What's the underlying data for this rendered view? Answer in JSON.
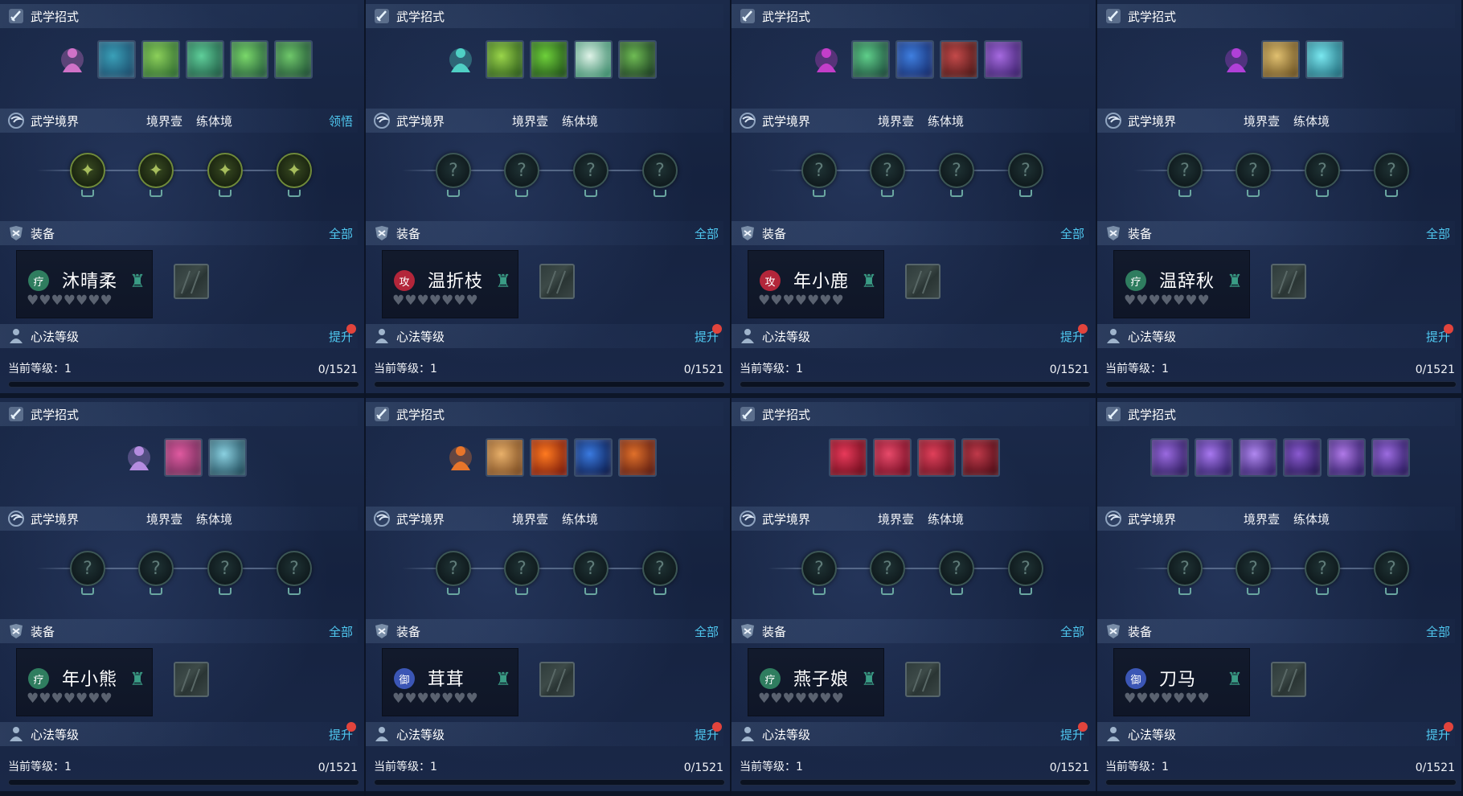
{
  "labels": {
    "moves": "武学招式",
    "realm": "武学境界",
    "realm_stage": "境界壹",
    "realm_type": "练体境",
    "comprehend": "领悟",
    "equip": "装备",
    "equip_all": "全部",
    "heart": "心法等级",
    "upgrade": "提升",
    "current_level_prefix": "当前等级：",
    "realm_unknown_glyph": "?"
  },
  "colors": {
    "accent": "#4fc7ef",
    "badge_heal": "#2f7d5f",
    "badge_attack": "#b3263a",
    "badge_defend": "#3b56b5",
    "red_dot": "#e2443c"
  },
  "characters": [
    {
      "name": "沐晴柔",
      "badge": "疗",
      "badge_type": "heal",
      "main_icon": "pink-figure-icon",
      "main_color": "#d072c8",
      "skills": [
        {
          "icon": "water-dragon-skill-icon",
          "colors": [
            "#3aa0b8",
            "#1b4a6a"
          ]
        },
        {
          "icon": "green-wind-skill-icon",
          "colors": [
            "#8cd05a",
            "#2e6a2f"
          ]
        },
        {
          "icon": "green-swirl-skill-icon",
          "colors": [
            "#5fcf9a",
            "#1f5a44"
          ]
        },
        {
          "icon": "green-leaf-skill-icon",
          "colors": [
            "#7ad86a",
            "#245a3a"
          ]
        },
        {
          "icon": "green-serpent-skill-icon",
          "colors": [
            "#6fc86a",
            "#1e4e34"
          ]
        }
      ],
      "realm_nodes_unlocked": true,
      "show_comprehend": true,
      "realm_icons": [
        "butterfly-icon",
        "crescent-icon",
        "lotus-icon",
        "crown-icon"
      ],
      "hearts": "♥♥♥♥♥♥♥",
      "level": "1",
      "exp": "0/1521",
      "progress": 0
    },
    {
      "name": "温折枝",
      "badge": "攻",
      "badge_type": "attack",
      "main_icon": "teal-figure-icon",
      "main_color": "#4fd0c4",
      "skills": [
        {
          "icon": "green-claw-skill-icon",
          "colors": [
            "#9ad54a",
            "#2c5a1a"
          ]
        },
        {
          "icon": "green-blade-skill-icon",
          "colors": [
            "#6ed03a",
            "#1f4f18"
          ]
        },
        {
          "icon": "white-ring-skill-icon",
          "colors": [
            "#dff3e8",
            "#3a8a6a"
          ]
        },
        {
          "icon": "green-yin-yang-skill-icon",
          "colors": [
            "#6fbc54",
            "#193a20"
          ]
        }
      ],
      "realm_nodes_unlocked": false,
      "show_comprehend": false,
      "hearts": "♥♥♥♥♥♥♥",
      "level": "1",
      "exp": "0/1521",
      "progress": 0
    },
    {
      "name": "年小鹿",
      "badge": "攻",
      "badge_type": "attack",
      "main_icon": "purple-orb-icon",
      "main_color": "#c33ec9",
      "skills": [
        {
          "icon": "green-burst-skill-icon",
          "colors": [
            "#5fcf8a",
            "#1b4a3a"
          ]
        },
        {
          "icon": "blue-wave-skill-icon",
          "colors": [
            "#3f7fe0",
            "#142a6a"
          ]
        },
        {
          "icon": "red-beast-skill-icon",
          "colors": [
            "#c44a4a",
            "#4a1616"
          ]
        },
        {
          "icon": "purple-mist-skill-icon",
          "colors": [
            "#a66ae0",
            "#3a1f6a"
          ]
        }
      ],
      "realm_nodes_unlocked": false,
      "show_comprehend": false,
      "hearts": "♥♥♥♥♥♥♥",
      "level": "1",
      "exp": "0/1521",
      "progress": 0
    },
    {
      "name": "温辞秋",
      "badge": "疗",
      "badge_type": "heal",
      "main_icon": "violet-figure-icon",
      "main_color": "#b040d8",
      "skills": [
        {
          "icon": "golden-wings-skill-icon",
          "colors": [
            "#e0c070",
            "#6a5020"
          ]
        },
        {
          "icon": "cyan-sun-skill-icon",
          "colors": [
            "#7ae8f0",
            "#1f6a7a"
          ]
        }
      ],
      "realm_nodes_unlocked": false,
      "show_comprehend": false,
      "hearts": "♥♥♥♥♥♥♥",
      "level": "1",
      "exp": "0/1521",
      "progress": 0
    },
    {
      "name": "年小熊",
      "badge": "疗",
      "badge_type": "heal",
      "main_icon": "purple-bell-icon",
      "main_color": "#b58ce0",
      "skills": [
        {
          "icon": "pink-bird-skill-icon",
          "colors": [
            "#e05aa0",
            "#6a2a55"
          ]
        },
        {
          "icon": "ice-shark-skill-icon",
          "colors": [
            "#8ad0e0",
            "#1f4a5a"
          ]
        }
      ],
      "realm_nodes_unlocked": false,
      "show_comprehend": false,
      "hearts": "♥♥♥♥♥♥♥",
      "level": "1",
      "exp": "0/1521",
      "progress": 0
    },
    {
      "name": "茸茸",
      "badge": "御",
      "badge_type": "defend",
      "main_icon": "flame-figure-icon",
      "main_color": "#e8752a",
      "skills": [
        {
          "icon": "golden-buddha-skill-icon",
          "colors": [
            "#e8b06a",
            "#7a4a20"
          ]
        },
        {
          "icon": "fire-blast-skill-icon",
          "colors": [
            "#ff7a20",
            "#7a1a0a"
          ]
        },
        {
          "icon": "blue-crescent-skill-icon",
          "colors": [
            "#3a7ae0",
            "#0a1a4a"
          ]
        },
        {
          "icon": "fire-swirl-skill-icon",
          "colors": [
            "#e0702a",
            "#5a1a10"
          ]
        }
      ],
      "realm_nodes_unlocked": false,
      "show_comprehend": false,
      "hearts": "♥♥♥♥♥♥♥",
      "level": "1",
      "exp": "0/1521",
      "progress": 0
    },
    {
      "name": "燕子娘",
      "badge": "疗",
      "badge_type": "heal",
      "main_icon": "",
      "main_color": "",
      "skills": [
        {
          "icon": "red-slash-skill-icon",
          "colors": [
            "#e83a5a",
            "#6a0a1a"
          ]
        },
        {
          "icon": "red-double-slash-skill-icon",
          "colors": [
            "#e84a6a",
            "#700a20"
          ]
        },
        {
          "icon": "red-rose-skill-icon",
          "colors": [
            "#e0405a",
            "#6a1020"
          ]
        },
        {
          "icon": "red-warrior-skill-icon",
          "colors": [
            "#c03a4a",
            "#4a0a14"
          ]
        }
      ],
      "realm_nodes_unlocked": false,
      "show_comprehend": false,
      "hearts": "♥♥♥♥♥♥♥",
      "level": "1",
      "exp": "0/1521",
      "progress": 0
    },
    {
      "name": "刀马",
      "badge": "御",
      "badge_type": "defend",
      "main_icon": "",
      "main_color": "",
      "skills": [
        {
          "icon": "purple-spear-skill-icon",
          "colors": [
            "#9a6ae0",
            "#2a1a5a"
          ]
        },
        {
          "icon": "purple-slash-skill-icon",
          "colors": [
            "#a878f0",
            "#2a1a60"
          ]
        },
        {
          "icon": "purple-arc-skill-icon",
          "colors": [
            "#b088f0",
            "#301a66"
          ]
        },
        {
          "icon": "purple-rider-skill-icon",
          "colors": [
            "#8a5ad0",
            "#221450"
          ]
        },
        {
          "icon": "purple-wave-skill-icon",
          "colors": [
            "#b07ae8",
            "#2a1860"
          ]
        },
        {
          "icon": "purple-halberd-skill-icon",
          "colors": [
            "#9c6ce0",
            "#26165a"
          ]
        }
      ],
      "realm_nodes_unlocked": false,
      "show_comprehend": false,
      "hearts": "♥♥♥♥♥♥♥",
      "level": "1",
      "exp": "0/1521",
      "progress": 0
    }
  ]
}
